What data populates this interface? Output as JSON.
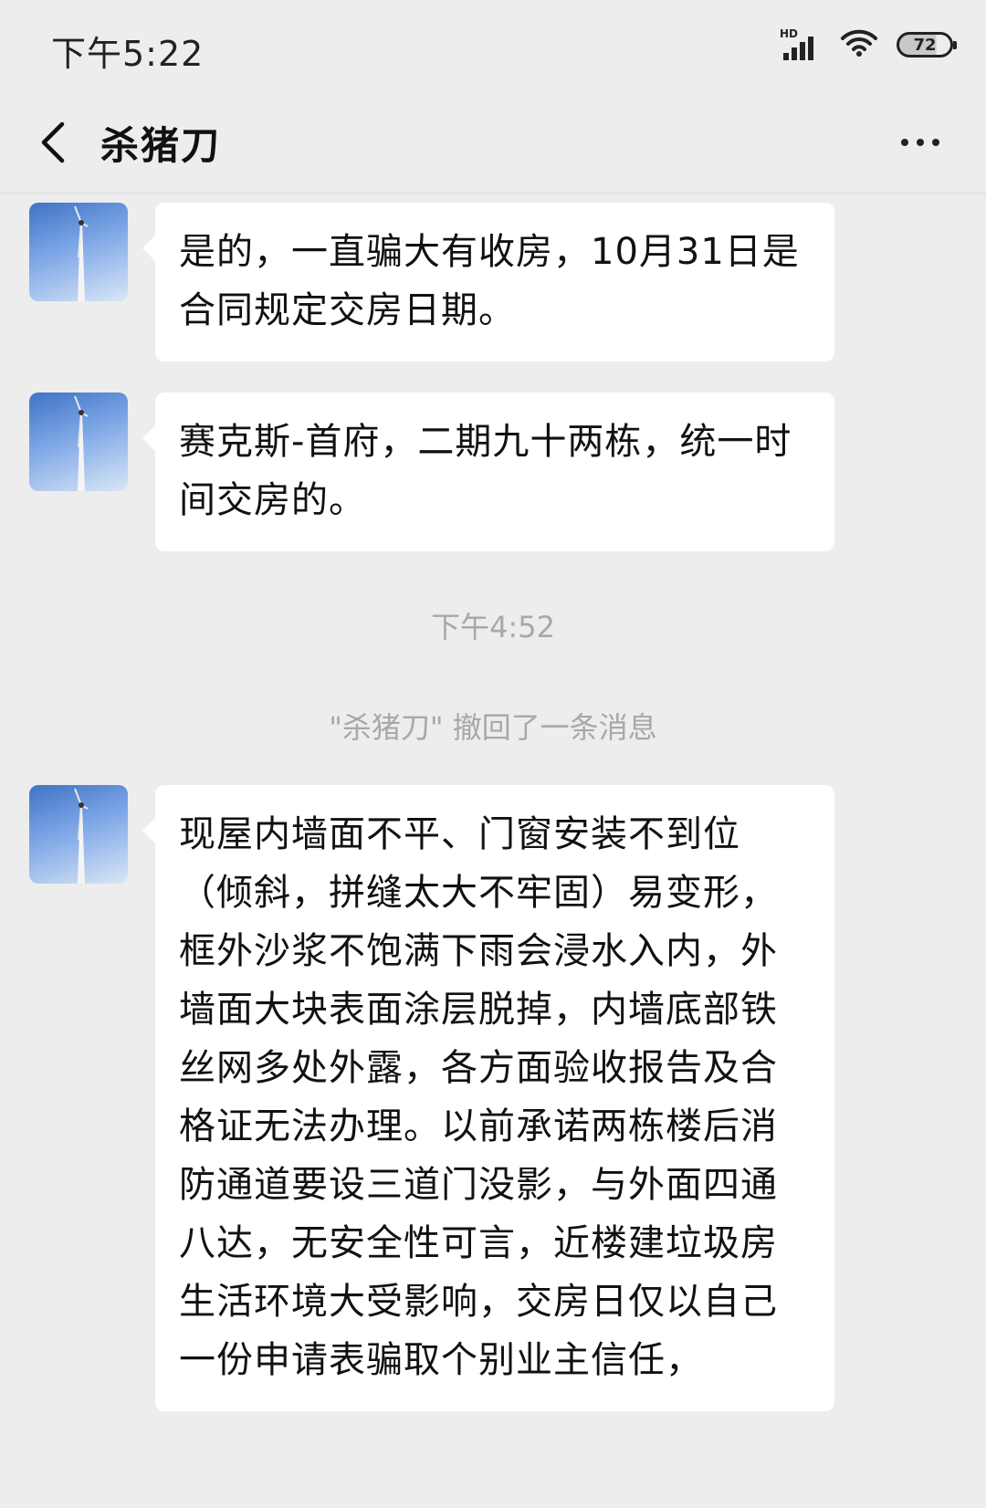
{
  "status_bar": {
    "time": "下午5:22",
    "network_label": "HD",
    "battery_level": "72",
    "battery_fraction": 0.72
  },
  "header": {
    "title": "杀猪刀"
  },
  "messages": [
    {
      "text": "是的，一直骗大有收房，10月31日是合同规定交房日期。"
    },
    {
      "text": "赛克斯-首府，二期九十两栋，统一时间交房的。"
    },
    {
      "text": "现屋内墙面不平、门窗安装不到位（倾斜，拼缝太大不牢固）易变形，框外沙浆不饱满下雨会浸水入内，外墙面大块表面涂层脱掉，内墙底部铁丝网多处外露，各方面验收报告及合格证无法办理。以前承诺两栋楼后消防通道要设三道门没影，与外面四通八达，无安全性可言，近楼建垃圾房生活环境大受影响，交房日仅以自己一份申请表骗取个别业主信任，"
    }
  ],
  "system": {
    "timestamp": "下午4:52",
    "recall_notice": "\"杀猪刀\" 撤回了一条消息"
  }
}
